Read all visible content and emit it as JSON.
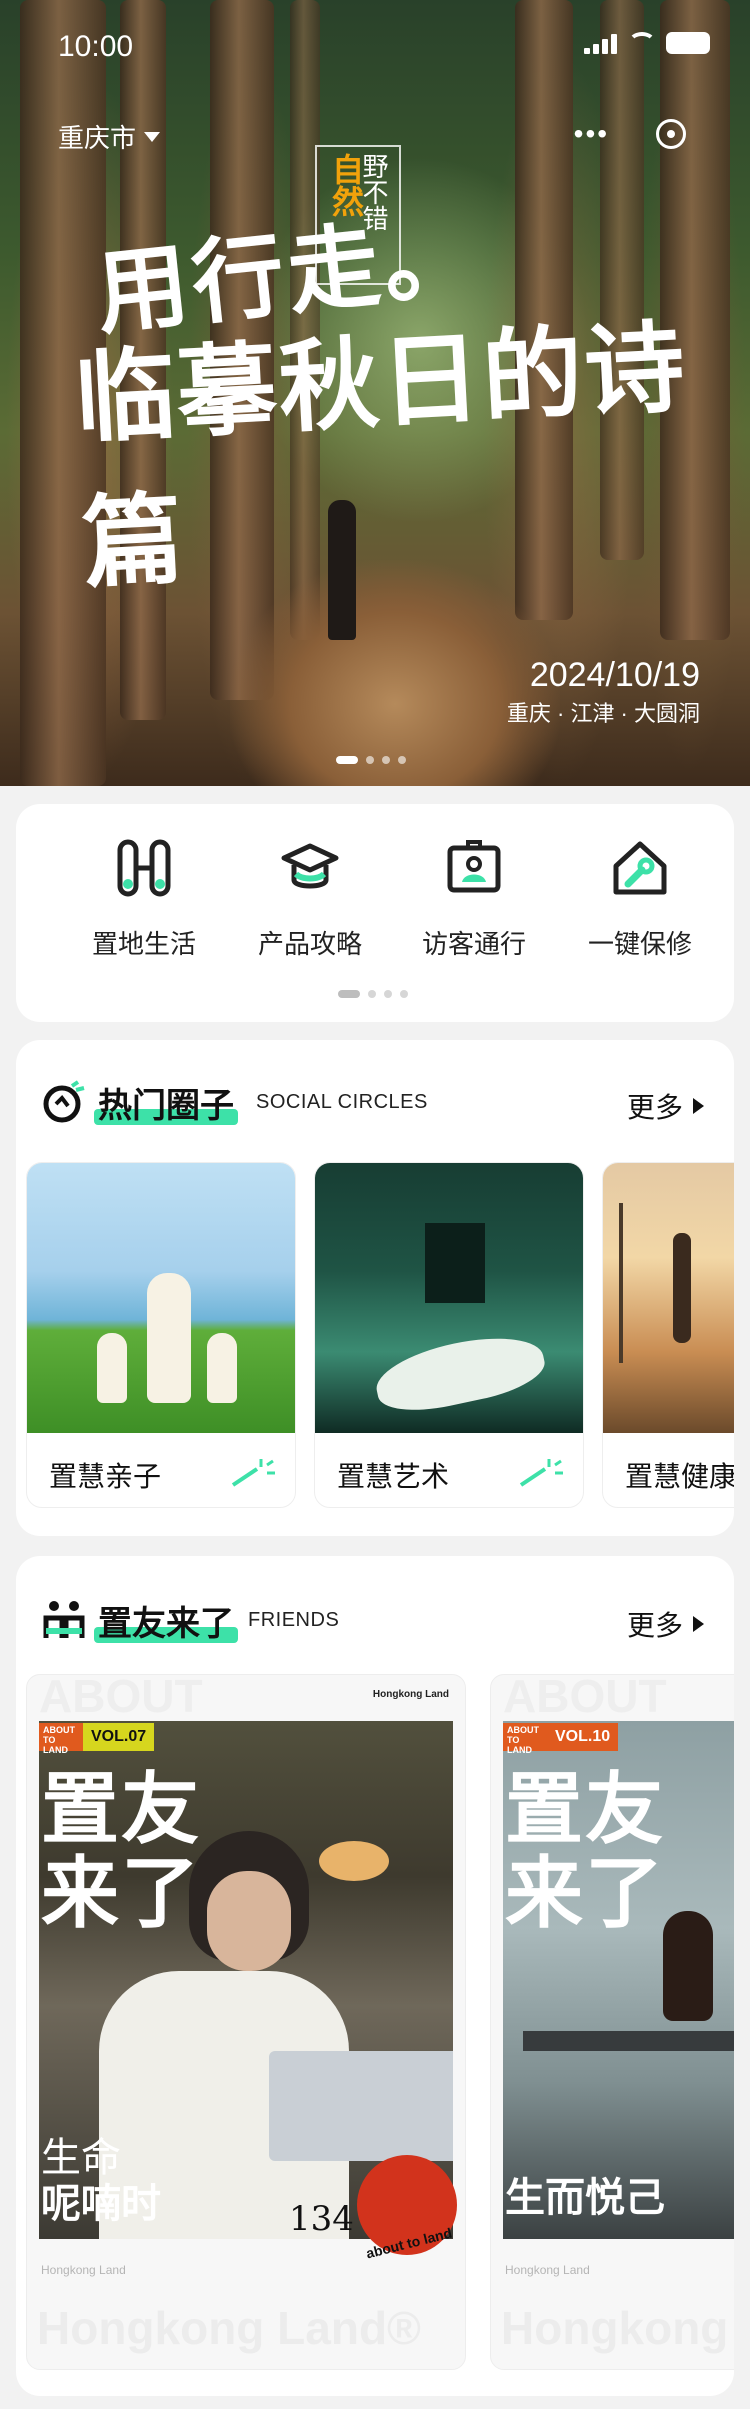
{
  "status": {
    "time": "10:00"
  },
  "header": {
    "city": "重庆市"
  },
  "hero": {
    "line1": "用行走。",
    "line2": "临摹秋日的诗篇",
    "stamp_main": "自然",
    "stamp_side": "野不错",
    "date": "2024/10/19",
    "location": "重庆 · 江津 · 大圆洞"
  },
  "quick_menu": [
    {
      "label": "置地生活",
      "icon": "life-icon"
    },
    {
      "label": "产品攻略",
      "icon": "graduation-cap-icon"
    },
    {
      "label": "访客通行",
      "icon": "visitor-id-icon"
    },
    {
      "label": "一键保修",
      "icon": "house-wrench-icon"
    }
  ],
  "circles": {
    "title": "热门圈子",
    "subtitle": "SOCIAL CIRCLES",
    "more": "更多",
    "items": [
      {
        "label": "置慧亲子"
      },
      {
        "label": "置慧艺术"
      },
      {
        "label": "置慧健康"
      }
    ]
  },
  "friends": {
    "title": "置友来了",
    "subtitle": "FRIENDS",
    "more": "更多",
    "items": [
      {
        "vol": "VOL.07",
        "vol_color": "#d6d61e",
        "title_l1": "置友",
        "title_l2": "来了",
        "tag_l1": "生命",
        "tag_l2": "呢喃时",
        "brand": "Hongkong Land",
        "watermark": "Hongkong Land®",
        "top_mark": "ABOUT",
        "corner": "Hongkong Land",
        "badge": "134",
        "logo_text": "about to land"
      },
      {
        "vol": "VOL.10",
        "vol_color": "#e05a1e",
        "title_l1": "置友",
        "title_l2": "来了",
        "tag_l1": "",
        "tag_l2": "生而悦己",
        "brand": "Hongkong Land",
        "watermark": "Hongkong Land",
        "top_mark": "ABOUT"
      }
    ],
    "vol_prefix": "ABOUT TO LAND"
  }
}
